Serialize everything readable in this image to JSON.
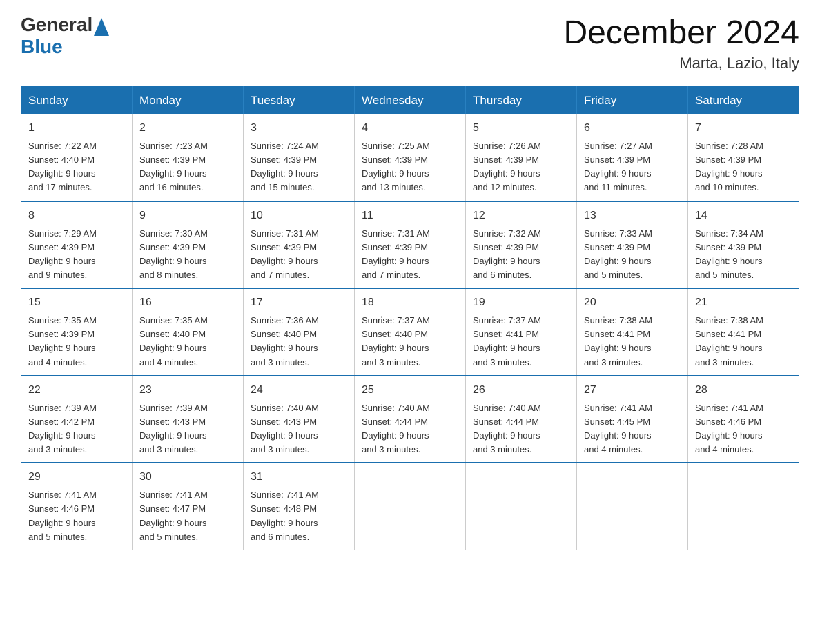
{
  "header": {
    "logo_general": "General",
    "logo_blue": "Blue",
    "month_year": "December 2024",
    "location": "Marta, Lazio, Italy"
  },
  "weekdays": [
    "Sunday",
    "Monday",
    "Tuesday",
    "Wednesday",
    "Thursday",
    "Friday",
    "Saturday"
  ],
  "weeks": [
    [
      {
        "day": "1",
        "sunrise": "7:22 AM",
        "sunset": "4:40 PM",
        "daylight": "9 hours and 17 minutes."
      },
      {
        "day": "2",
        "sunrise": "7:23 AM",
        "sunset": "4:39 PM",
        "daylight": "9 hours and 16 minutes."
      },
      {
        "day": "3",
        "sunrise": "7:24 AM",
        "sunset": "4:39 PM",
        "daylight": "9 hours and 15 minutes."
      },
      {
        "day": "4",
        "sunrise": "7:25 AM",
        "sunset": "4:39 PM",
        "daylight": "9 hours and 13 minutes."
      },
      {
        "day": "5",
        "sunrise": "7:26 AM",
        "sunset": "4:39 PM",
        "daylight": "9 hours and 12 minutes."
      },
      {
        "day": "6",
        "sunrise": "7:27 AM",
        "sunset": "4:39 PM",
        "daylight": "9 hours and 11 minutes."
      },
      {
        "day": "7",
        "sunrise": "7:28 AM",
        "sunset": "4:39 PM",
        "daylight": "9 hours and 10 minutes."
      }
    ],
    [
      {
        "day": "8",
        "sunrise": "7:29 AM",
        "sunset": "4:39 PM",
        "daylight": "9 hours and 9 minutes."
      },
      {
        "day": "9",
        "sunrise": "7:30 AM",
        "sunset": "4:39 PM",
        "daylight": "9 hours and 8 minutes."
      },
      {
        "day": "10",
        "sunrise": "7:31 AM",
        "sunset": "4:39 PM",
        "daylight": "9 hours and 7 minutes."
      },
      {
        "day": "11",
        "sunrise": "7:31 AM",
        "sunset": "4:39 PM",
        "daylight": "9 hours and 7 minutes."
      },
      {
        "day": "12",
        "sunrise": "7:32 AM",
        "sunset": "4:39 PM",
        "daylight": "9 hours and 6 minutes."
      },
      {
        "day": "13",
        "sunrise": "7:33 AM",
        "sunset": "4:39 PM",
        "daylight": "9 hours and 5 minutes."
      },
      {
        "day": "14",
        "sunrise": "7:34 AM",
        "sunset": "4:39 PM",
        "daylight": "9 hours and 5 minutes."
      }
    ],
    [
      {
        "day": "15",
        "sunrise": "7:35 AM",
        "sunset": "4:39 PM",
        "daylight": "9 hours and 4 minutes."
      },
      {
        "day": "16",
        "sunrise": "7:35 AM",
        "sunset": "4:40 PM",
        "daylight": "9 hours and 4 minutes."
      },
      {
        "day": "17",
        "sunrise": "7:36 AM",
        "sunset": "4:40 PM",
        "daylight": "9 hours and 3 minutes."
      },
      {
        "day": "18",
        "sunrise": "7:37 AM",
        "sunset": "4:40 PM",
        "daylight": "9 hours and 3 minutes."
      },
      {
        "day": "19",
        "sunrise": "7:37 AM",
        "sunset": "4:41 PM",
        "daylight": "9 hours and 3 minutes."
      },
      {
        "day": "20",
        "sunrise": "7:38 AM",
        "sunset": "4:41 PM",
        "daylight": "9 hours and 3 minutes."
      },
      {
        "day": "21",
        "sunrise": "7:38 AM",
        "sunset": "4:41 PM",
        "daylight": "9 hours and 3 minutes."
      }
    ],
    [
      {
        "day": "22",
        "sunrise": "7:39 AM",
        "sunset": "4:42 PM",
        "daylight": "9 hours and 3 minutes."
      },
      {
        "day": "23",
        "sunrise": "7:39 AM",
        "sunset": "4:43 PM",
        "daylight": "9 hours and 3 minutes."
      },
      {
        "day": "24",
        "sunrise": "7:40 AM",
        "sunset": "4:43 PM",
        "daylight": "9 hours and 3 minutes."
      },
      {
        "day": "25",
        "sunrise": "7:40 AM",
        "sunset": "4:44 PM",
        "daylight": "9 hours and 3 minutes."
      },
      {
        "day": "26",
        "sunrise": "7:40 AM",
        "sunset": "4:44 PM",
        "daylight": "9 hours and 3 minutes."
      },
      {
        "day": "27",
        "sunrise": "7:41 AM",
        "sunset": "4:45 PM",
        "daylight": "9 hours and 4 minutes."
      },
      {
        "day": "28",
        "sunrise": "7:41 AM",
        "sunset": "4:46 PM",
        "daylight": "9 hours and 4 minutes."
      }
    ],
    [
      {
        "day": "29",
        "sunrise": "7:41 AM",
        "sunset": "4:46 PM",
        "daylight": "9 hours and 5 minutes."
      },
      {
        "day": "30",
        "sunrise": "7:41 AM",
        "sunset": "4:47 PM",
        "daylight": "9 hours and 5 minutes."
      },
      {
        "day": "31",
        "sunrise": "7:41 AM",
        "sunset": "4:48 PM",
        "daylight": "9 hours and 6 minutes."
      },
      null,
      null,
      null,
      null
    ]
  ],
  "labels": {
    "sunrise": "Sunrise:",
    "sunset": "Sunset:",
    "daylight": "Daylight:"
  }
}
